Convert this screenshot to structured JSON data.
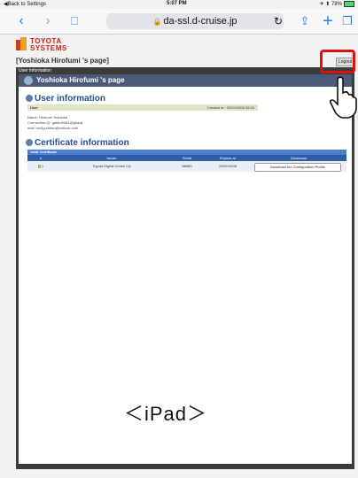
{
  "status_bar": {
    "back": "◀Back to Settings",
    "time": "5:07 PM",
    "right": "✈ ⬆ 78%"
  },
  "browser": {
    "url": "da-ssl.d-cruise.jp"
  },
  "logo": {
    "line1": "TOYOTA",
    "line2": "SYSTEMS"
  },
  "page": {
    "title": "[Yoshioka Hirofumi 's page]",
    "logout": "Logout"
  },
  "panel": {
    "head": "User Information",
    "banner": "Yoshioka Hirofumi 's page"
  },
  "user_info": {
    "heading": "User information",
    "bar_label": "User",
    "created": "Created at : 2019/10/06 06:03",
    "name": "Name: Hirofumi Yoshioka",
    "connection": "Connection ID: gatdm0081@global",
    "mail": "mail: mo3g-shitou@outlook.com"
  },
  "cert_info": {
    "heading": "Certificate information",
    "bar_label": "Valid Certificate",
    "columns": [
      "#",
      "Issuer",
      "Serial",
      "Expires at",
      "Download"
    ],
    "rows": [
      {
        "num": "1",
        "issuer": "Toyota Digital Cruise CA",
        "serial": "86880",
        "expires": "2020/10/06",
        "download": "Download the Configuration Profile"
      }
    ]
  },
  "caption": "＜iPad＞",
  "colors": {
    "accent": "#2f7bf5",
    "header": "#4a5b78",
    "table_head": "#2f5ea8",
    "highlight": "#dd1111"
  }
}
